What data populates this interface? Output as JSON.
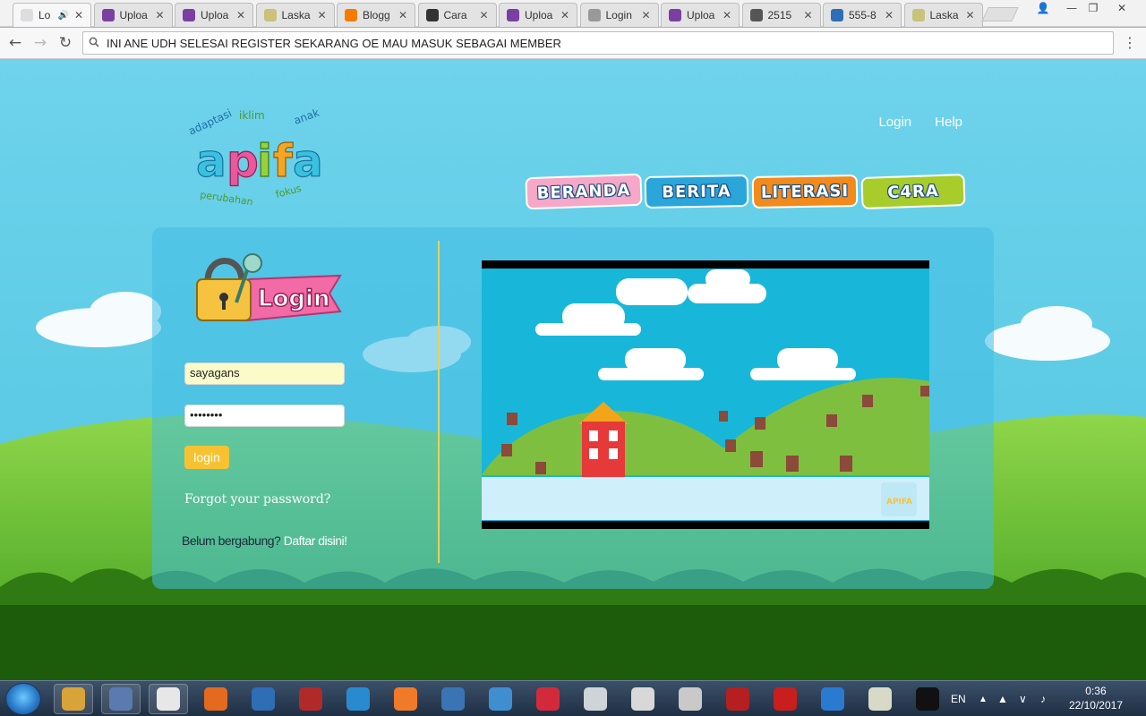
{
  "browser": {
    "tabs": [
      {
        "title": "Lo",
        "favicon": "document-icon",
        "color": "#dddddd"
      },
      {
        "title": "Uploa",
        "favicon": "imgur-icon",
        "color": "#7b3fa1"
      },
      {
        "title": "Uploa",
        "favicon": "imgur-icon",
        "color": "#7b3fa1"
      },
      {
        "title": "Laska",
        "favicon": "kaskus-icon",
        "color": "#c9c27a"
      },
      {
        "title": "Blogg",
        "favicon": "blogger-icon",
        "color": "#f57c00"
      },
      {
        "title": "Cara",
        "favicon": "terminal-icon",
        "color": "#333333"
      },
      {
        "title": "Uploa",
        "favicon": "imgur-icon",
        "color": "#7b3fa1"
      },
      {
        "title": "Login",
        "favicon": "key-icon",
        "color": "#999999"
      },
      {
        "title": "Uploa",
        "favicon": "imgur-icon",
        "color": "#7b3fa1"
      },
      {
        "title": "2515",
        "favicon": "pkp-icon",
        "color": "#555555"
      },
      {
        "title": "555-8",
        "favicon": "js-icon",
        "color": "#2f6db5"
      },
      {
        "title": "Laska",
        "favicon": "kaskus-icon",
        "color": "#c9c27a"
      }
    ],
    "address": "INI ANE UDH SELESAI REGISTER SEKARANG OE MAU MASUK SEBAGAI MEMBER"
  },
  "site": {
    "logo": {
      "text": "apifa",
      "tags": [
        "adaptasi",
        "iklim",
        "anak",
        "perubahan",
        "fokus"
      ]
    },
    "top_links": [
      "Login",
      "Help"
    ],
    "nav": [
      {
        "label": "BERANDA",
        "color": "#f6a9c8"
      },
      {
        "label": "BERITA",
        "color": "#2aa6da"
      },
      {
        "label": "LITERASI",
        "color": "#f28a1c"
      },
      {
        "label": "C4RA",
        "color": "#a8cc2a"
      }
    ]
  },
  "login": {
    "badge": "Login",
    "username": "sayagans",
    "password_mask": "••••••••",
    "button": "login",
    "forgot": "Forgot your password?",
    "join_question": "Belum bergabung?",
    "join_link": "Daftar disini!"
  },
  "video": {
    "watermark": "APIFA"
  },
  "taskbar": {
    "apps": [
      "explorer-icon",
      "media-player-icon",
      "chrome-icon",
      "firefox-icon",
      "network-icon",
      "radiation-icon",
      "wireshark-icon",
      "xampp-icon",
      "python-icon",
      "globe-network-icon",
      "dots-app-icon",
      "inkscape-icon",
      "presentation-icon",
      "snipping-tool-icon",
      "filezilla-icon",
      "ruby-icon",
      "shark-icon",
      "notes-icon",
      "cmd-icon"
    ],
    "language": "EN",
    "time": "0:36",
    "date": "22/10/2017"
  }
}
